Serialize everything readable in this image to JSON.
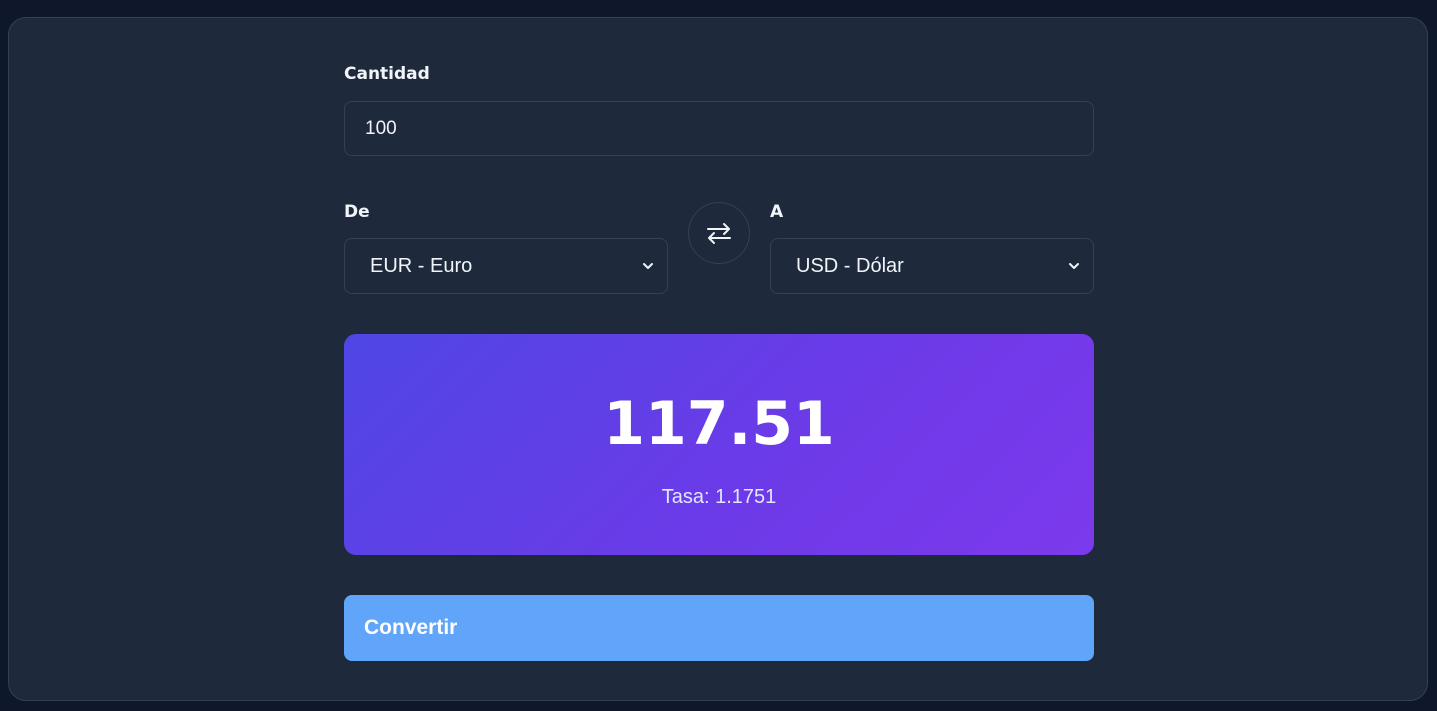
{
  "form": {
    "amount_label": "Cantidad",
    "amount_value": "100",
    "from_label": "De",
    "from_selected": "EUR - Euro",
    "to_label": "A",
    "to_selected": "USD - Dólar"
  },
  "icons": {
    "swap": "swap-arrows-icon",
    "dropdown": "chevron-down-icon"
  },
  "result": {
    "value": "117.51",
    "rate_text": "Tasa: 1.1751"
  },
  "actions": {
    "convert_label": "Convertir"
  },
  "colors": {
    "background": "#0f172a",
    "card": "#1e293b",
    "gradient_start": "#4f46e5",
    "gradient_end": "#7c3aed",
    "button": "#60a5fa"
  }
}
